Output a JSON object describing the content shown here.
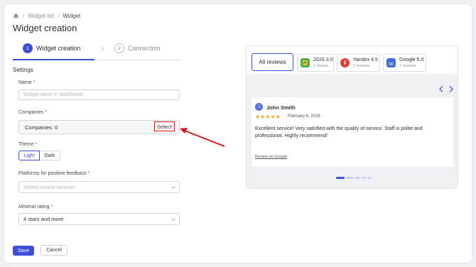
{
  "breadcrumb": {
    "items": [
      "Widget list",
      "Widget"
    ]
  },
  "page": {
    "title": "Widget creation"
  },
  "steps": [
    {
      "num": "1",
      "label": "Widget creation"
    },
    {
      "num": "2",
      "label": "Connection"
    }
  ],
  "settings": {
    "heading": "Settings",
    "name": {
      "label": "Name",
      "placeholder": "Widget name in dashboard"
    },
    "companies": {
      "label": "Companies",
      "value": "Companies: 0",
      "select_label": "Select"
    },
    "theme": {
      "label": "Theme",
      "options": [
        "Light",
        "Dark"
      ],
      "selected": "Light"
    },
    "platforms": {
      "label": "Platforms for positive feedback",
      "placeholder": "Select review sources"
    },
    "rating": {
      "label": "Minimal rating",
      "value": "4 stars and more"
    },
    "required_mark": "*"
  },
  "actions": {
    "save": "Save",
    "cancel": "Cancel"
  },
  "preview": {
    "all_tab": "All reviews",
    "sources": [
      {
        "name": "2GIS 3.0",
        "count": "1 review",
        "color": "#4caf50",
        "icon": "2gis-icon"
      },
      {
        "name": "Yandex 4.5",
        "count": "2 reviews",
        "color": "#e53935",
        "icon": "yandex-icon"
      },
      {
        "name": "Google 5.0",
        "count": "2 reviews",
        "color": "#3f6ed8",
        "icon": "google-icon"
      }
    ],
    "review": {
      "initial": "J",
      "author": "John Smith",
      "stars": "★★★★★",
      "rating": 5,
      "date": "February 6, 2026",
      "text": "Excellent service! Very satisfied with the quality of service. Staff is polite and professional. Highly recommend!",
      "link": "Review on Google"
    }
  },
  "colors": {
    "accent": "#3b4fd8",
    "highlight": "#d8141c",
    "star": "#f5a623"
  }
}
